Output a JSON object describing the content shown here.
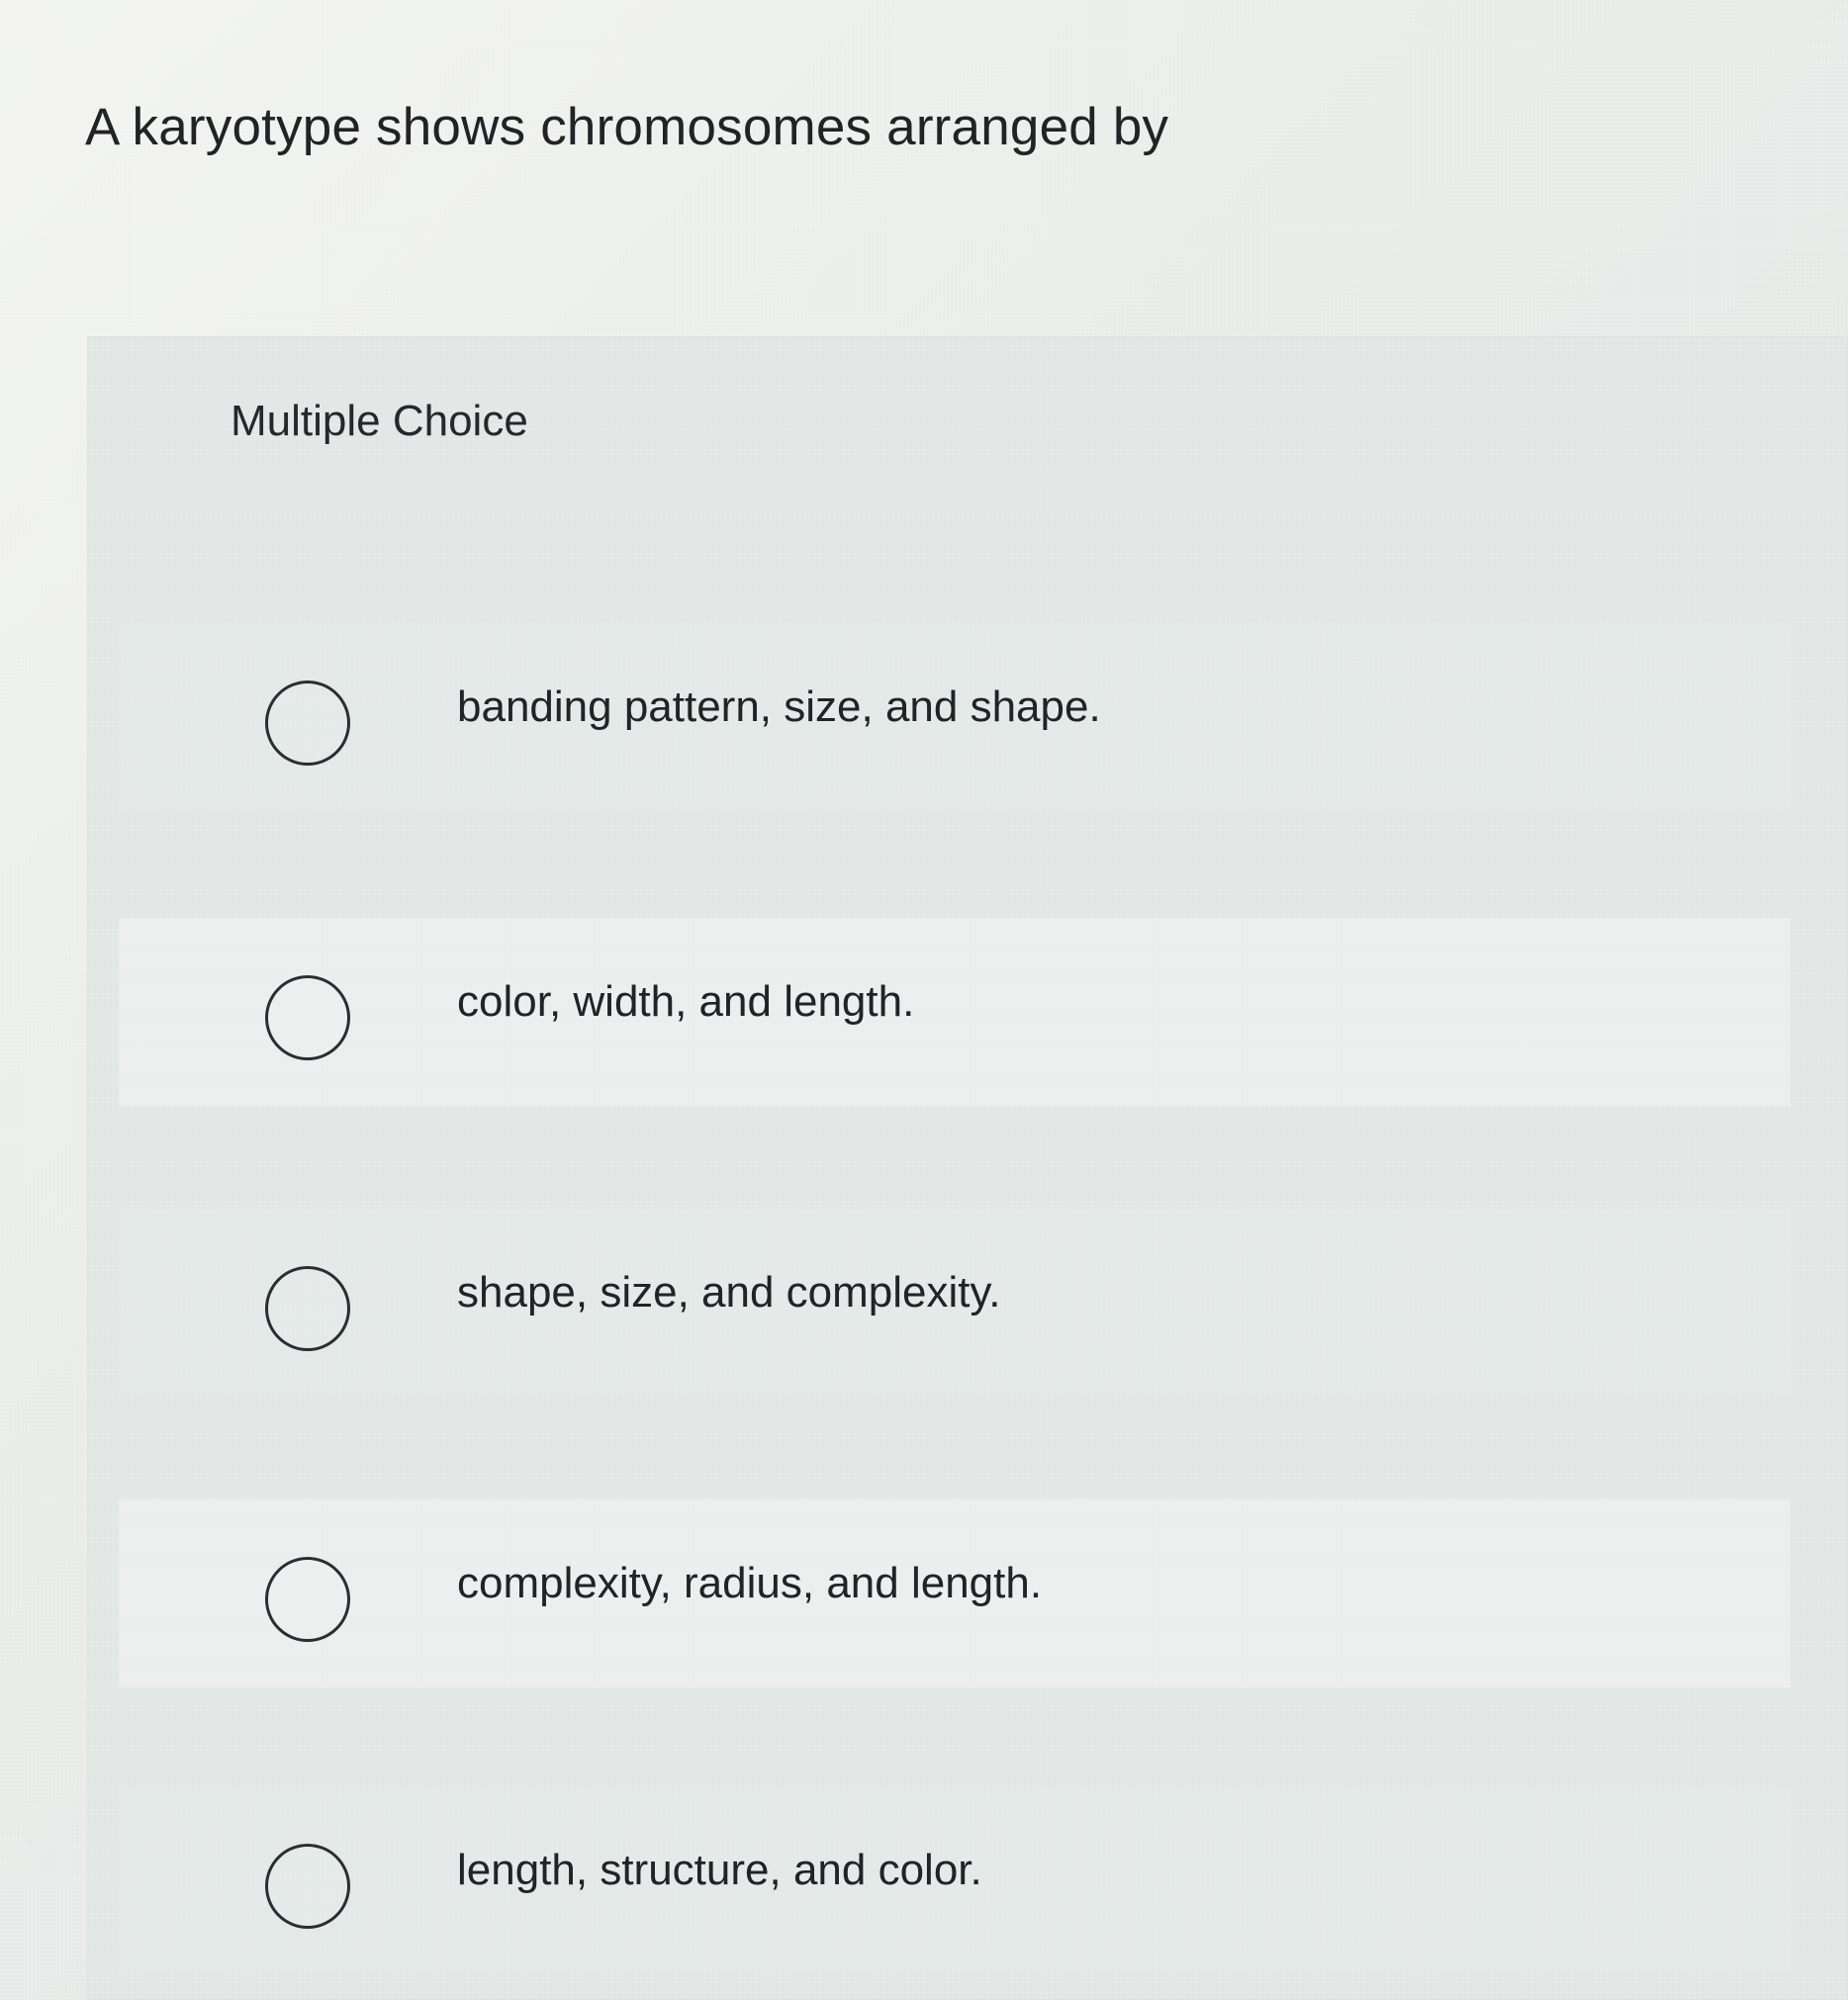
{
  "question": {
    "prompt": "A karyotype shows chromosomes arranged by",
    "type_label": "Multiple Choice",
    "choices": [
      {
        "label": "banding pattern, size, and shape."
      },
      {
        "label": "color, width, and length."
      },
      {
        "label": "shape, size, and complexity."
      },
      {
        "label": "complexity, radius, and length."
      },
      {
        "label": "length, structure, and color."
      }
    ]
  },
  "icons": {
    "choice_marker": "radio-button-icon"
  },
  "colors": {
    "background": "#e7ebe9",
    "text": "#202426",
    "radio_border": "#2b2e30"
  }
}
